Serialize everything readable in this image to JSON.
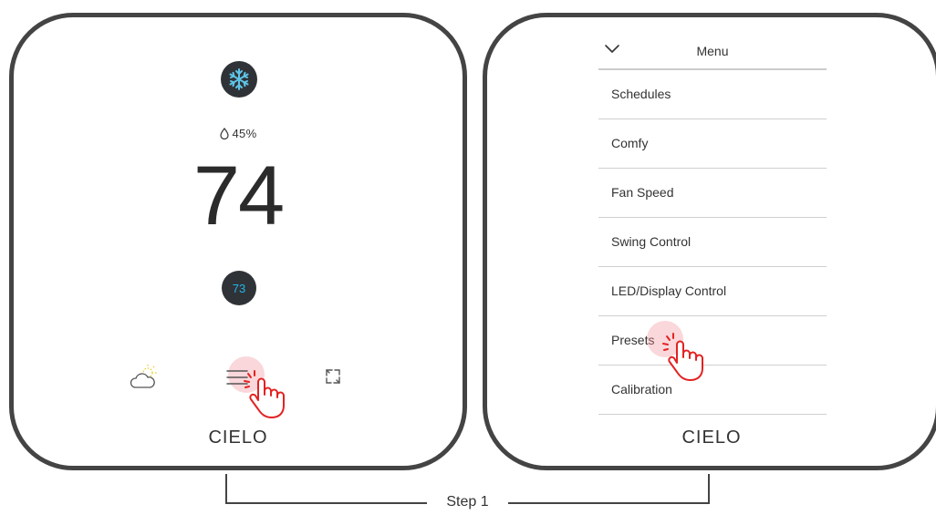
{
  "left_device": {
    "humidity": "45%",
    "temperature": "74",
    "setpoint": "73",
    "logo": "CIELO",
    "icons": {
      "mode": "snowflake-icon",
      "weather": "sun-cloud-icon",
      "menu": "hamburger-menu-icon",
      "expand": "expand-icon",
      "humidity": "droplet-icon"
    },
    "colors": {
      "dark_circle": "#2f3338",
      "setpoint_text": "#26b3e6",
      "snowflake": "#5ec4e8",
      "weather_sun": "#e9d23a"
    }
  },
  "right_device": {
    "menu_title": "Menu",
    "menu_items": [
      "Schedules",
      "Comfy",
      "Fan Speed",
      "Swing Control",
      "LED/Display Control",
      "Presets",
      "Calibration"
    ],
    "logo": "CIELO",
    "icons": {
      "collapse": "chevron-down-icon"
    }
  },
  "step_label": "Step 1",
  "accent": {
    "tap_hand": "#e32222",
    "tap_glow": "#f08c96"
  }
}
